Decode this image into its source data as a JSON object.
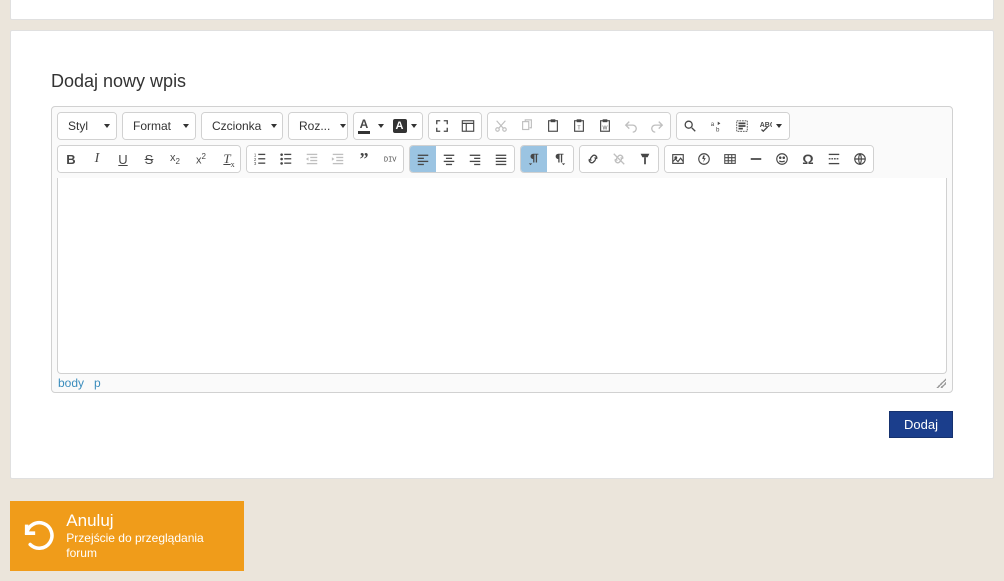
{
  "heading": "Dodaj nowy wpis",
  "dropdowns": {
    "style": "Styl",
    "format": "Format",
    "font": "Czcionka",
    "size": "Roz..."
  },
  "path": {
    "body": "body",
    "p": "p"
  },
  "submit_label": "Dodaj",
  "cancel": {
    "title": "Anuluj",
    "subtitle": "Przejście do przeglądania forum"
  }
}
